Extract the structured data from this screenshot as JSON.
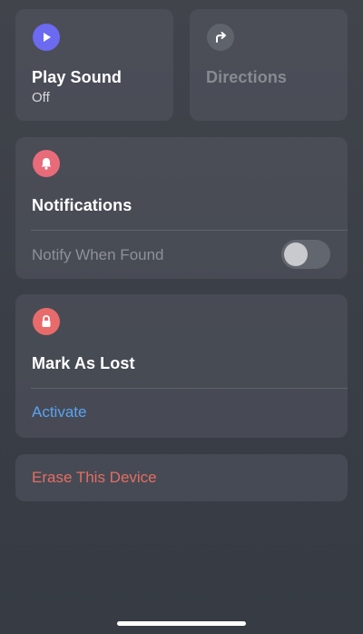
{
  "play_sound": {
    "title": "Play Sound",
    "status": "Off",
    "icon": "play-icon",
    "icon_color": "#6b6af0"
  },
  "directions": {
    "title": "Directions",
    "icon": "directions-arrow-icon",
    "icon_color": "#5f636b"
  },
  "notifications": {
    "title": "Notifications",
    "icon": "bell-icon",
    "icon_color": "#e86b7a",
    "notify_label": "Notify When Found",
    "toggle_on": false
  },
  "mark_as_lost": {
    "title": "Mark As Lost",
    "icon": "lock-icon",
    "icon_color": "#e86b6b",
    "action_label": "Activate",
    "action_color": "#5aa2f2"
  },
  "erase": {
    "label": "Erase This Device",
    "color": "#e36e62"
  }
}
